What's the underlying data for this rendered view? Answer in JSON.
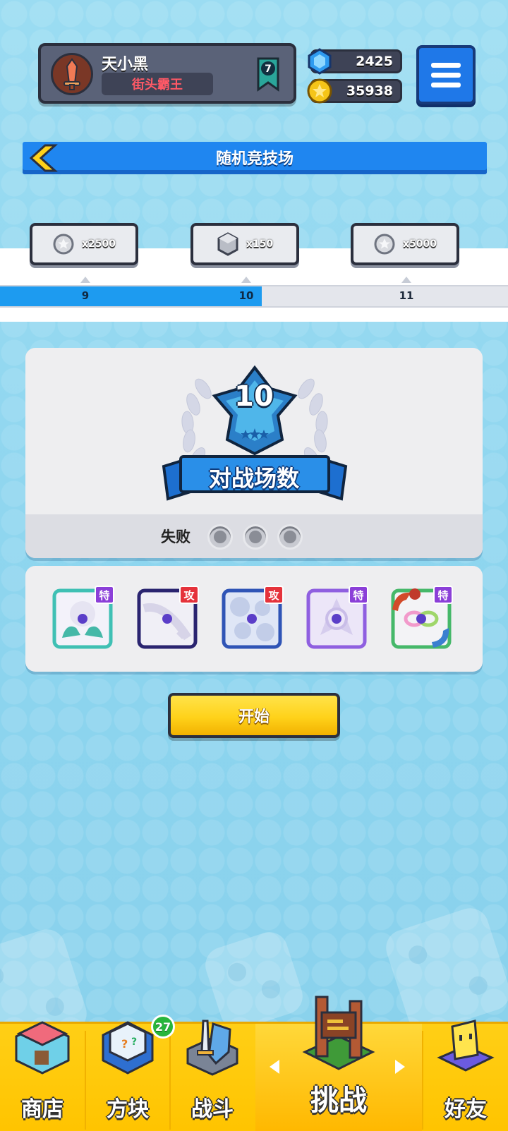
{
  "player": {
    "name": "天小黑",
    "title": "街头霸王",
    "rank_level": "7"
  },
  "currency": {
    "gems": "2425",
    "coins": "35938"
  },
  "header": {
    "title": "随机竞技场"
  },
  "reward_track": {
    "progress_fraction": 0.515,
    "milestones": [
      {
        "level": "9",
        "reward_amount": "x2500",
        "reward_icon": "silver-coin-icon"
      },
      {
        "level": "10",
        "reward_amount": "x150",
        "reward_icon": "gem-cube-icon"
      },
      {
        "level": "11",
        "reward_amount": "x5000",
        "reward_icon": "silver-coin-icon"
      }
    ]
  },
  "battle": {
    "count": "10",
    "label": "对战场数",
    "lose_label": "失败",
    "losses_used": 0,
    "losses_max": 3
  },
  "skills": [
    {
      "tag": "特",
      "tag_color": "#8b3fd8",
      "frame": "#3fc0b4",
      "icon": "healing-hands-icon"
    },
    {
      "tag": "攻",
      "tag_color": "#e5323b",
      "frame": "#2a2470",
      "icon": "slash-icon"
    },
    {
      "tag": "攻",
      "tag_color": "#e5323b",
      "frame": "#2f54b6",
      "icon": "gears-icon"
    },
    {
      "tag": "特",
      "tag_color": "#8b3fd8",
      "frame": "#8f5fe0",
      "icon": "arrows-icon"
    },
    {
      "tag": "特",
      "tag_color": "#8b3fd8",
      "frame": "#46b86a",
      "icon": "dragon-infinity-icon"
    }
  ],
  "start_button": {
    "label": "开始"
  },
  "nav": {
    "items": [
      {
        "label": "商店",
        "icon": "shop-icon"
      },
      {
        "label": "方块",
        "icon": "dice-block-icon",
        "badge": "27"
      },
      {
        "label": "战斗",
        "icon": "sword-shield-icon"
      },
      {
        "label": "挑战",
        "icon": "challenge-board-icon",
        "active": true
      },
      {
        "label": "好友",
        "icon": "friend-icon"
      }
    ]
  },
  "colors": {
    "accent_blue": "#1f86f0",
    "nav_yellow": "#ffc400",
    "start_yellow": "#ffd21a"
  }
}
